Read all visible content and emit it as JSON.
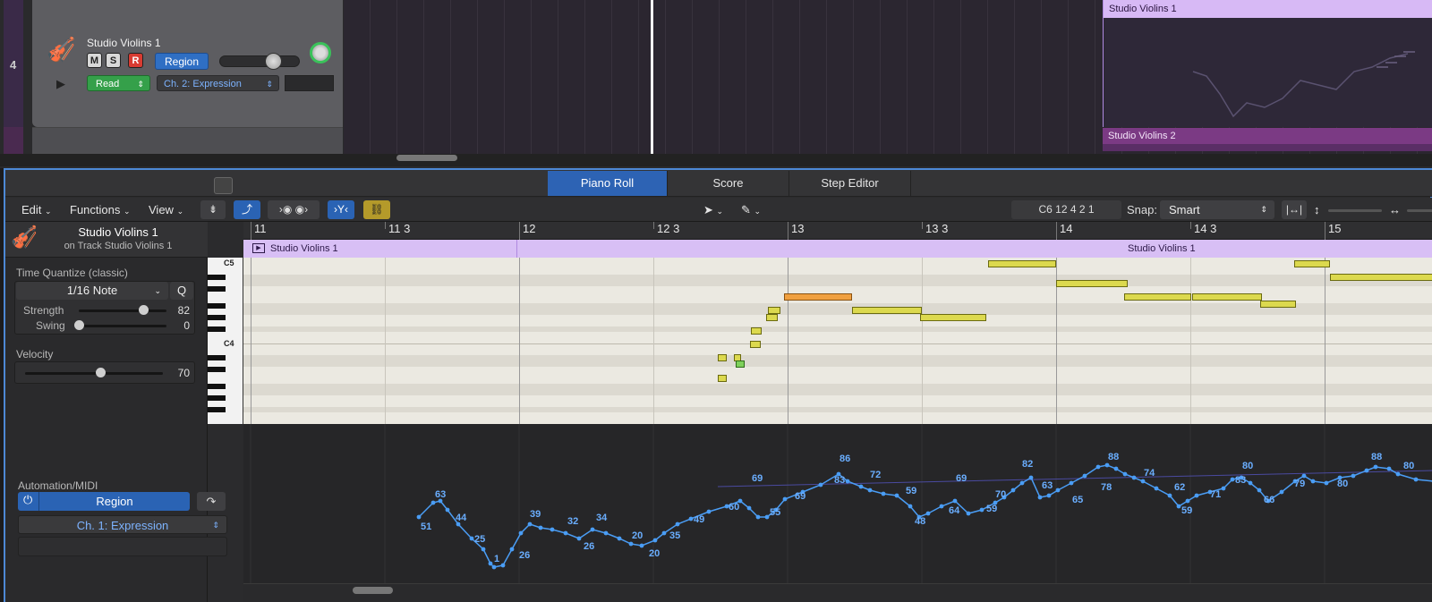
{
  "track": {
    "number": "4",
    "name": "Studio Violins 1",
    "mute": "M",
    "solo": "S",
    "record": "R",
    "region_btn": "Region",
    "automation_mode": "Read",
    "automation_param": "Ch. 2: Expression"
  },
  "arrange": {
    "region1_name": "Studio Violins 1",
    "region2_name": "Studio Violins 2"
  },
  "editor_tabs": [
    {
      "label": "Piano Roll",
      "active": true
    },
    {
      "label": "Score",
      "active": false
    },
    {
      "label": "Step Editor",
      "active": false
    }
  ],
  "toolbar": {
    "edit": "Edit",
    "functions": "Functions",
    "view": "View",
    "position": "C6   12 4 2 1",
    "snap_label": "Snap:",
    "snap_value": "Smart"
  },
  "inspector": {
    "title": "Studio Violins 1",
    "subtitle": "on Track Studio Violins 1",
    "time_quantize_label": "Time Quantize (classic)",
    "quantize_value": "1/16 Note",
    "q_button": "Q",
    "strength_label": "Strength",
    "strength_value": "82",
    "swing_label": "Swing",
    "swing_value": "0",
    "velocity_label": "Velocity",
    "velocity_value": "70"
  },
  "piano_roll": {
    "ruler": [
      "11",
      "11 3",
      "12",
      "12 3",
      "13",
      "13 3",
      "14",
      "14 3",
      "15"
    ],
    "region_name": "Studio Violins 1",
    "region_name_2": "Studio Violins 1",
    "key_labels": {
      "c5": "C5",
      "c4": "C4"
    }
  },
  "automation": {
    "label": "Automation/MIDI",
    "region": "Region",
    "channel": "Ch. 1: Expression",
    "point_labels": [
      "51",
      "63",
      "44",
      "25",
      "1",
      "26",
      "39",
      "32",
      "26",
      "34",
      "20",
      "20",
      "35",
      "49",
      "60",
      "69",
      "55",
      "69",
      "86",
      "83",
      "72",
      "59",
      "48",
      "64",
      "69",
      "59",
      "70",
      "82",
      "63",
      "65",
      "78",
      "88",
      "74",
      "62",
      "59",
      "71",
      "83",
      "80",
      "66",
      "79",
      "80",
      "88",
      "80"
    ]
  },
  "colors": {
    "accent": "#2d63b4",
    "region_purple": "#d8bff5",
    "note_yellow": "#dcd94e",
    "note_orange": "#f0a040",
    "automation_line": "#4a9df5"
  }
}
